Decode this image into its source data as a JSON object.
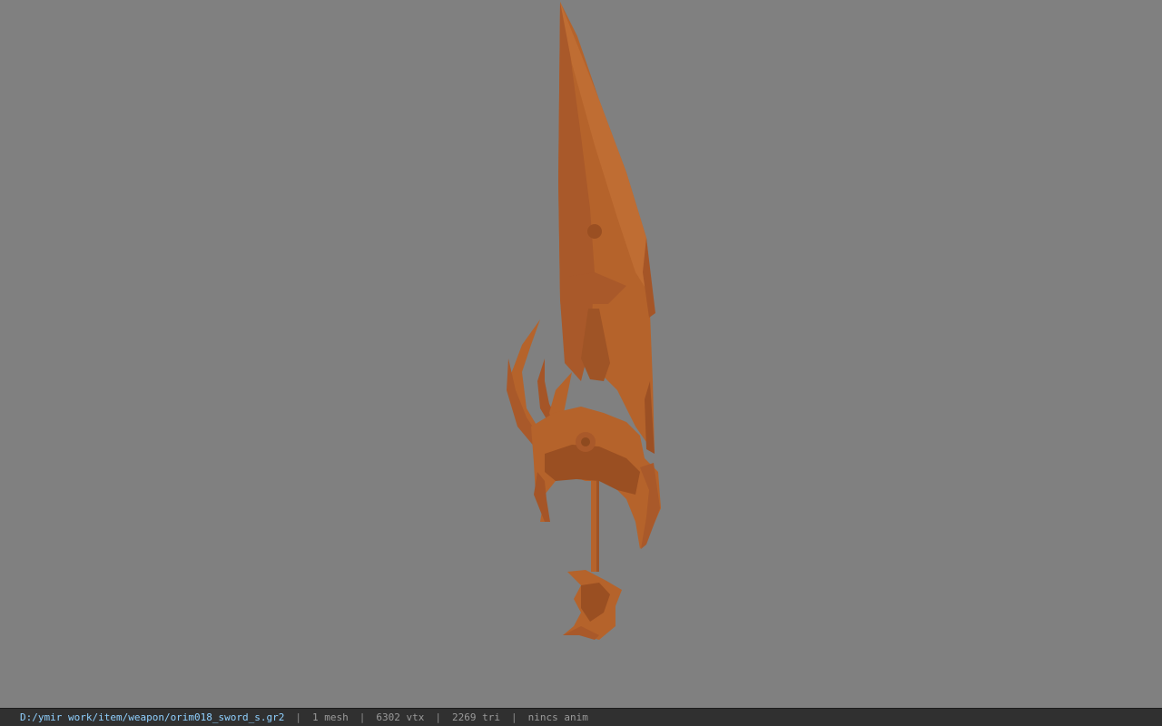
{
  "viewport": {
    "background_color": "#808080",
    "model_color": "#b5632b",
    "model_shadow_color": "#8e4a1f",
    "model_highlight_color": "#c9783b",
    "model_name": "sword-model"
  },
  "status_bar": {
    "file_path": "D:/ymir work/item/weapon/orim018_sword_s.gr2",
    "separator": "|",
    "mesh_count": "1 mesh",
    "vertex_count": "6302 vtx",
    "triangle_count": "2269 tri",
    "anim_status": "nincs anim"
  }
}
